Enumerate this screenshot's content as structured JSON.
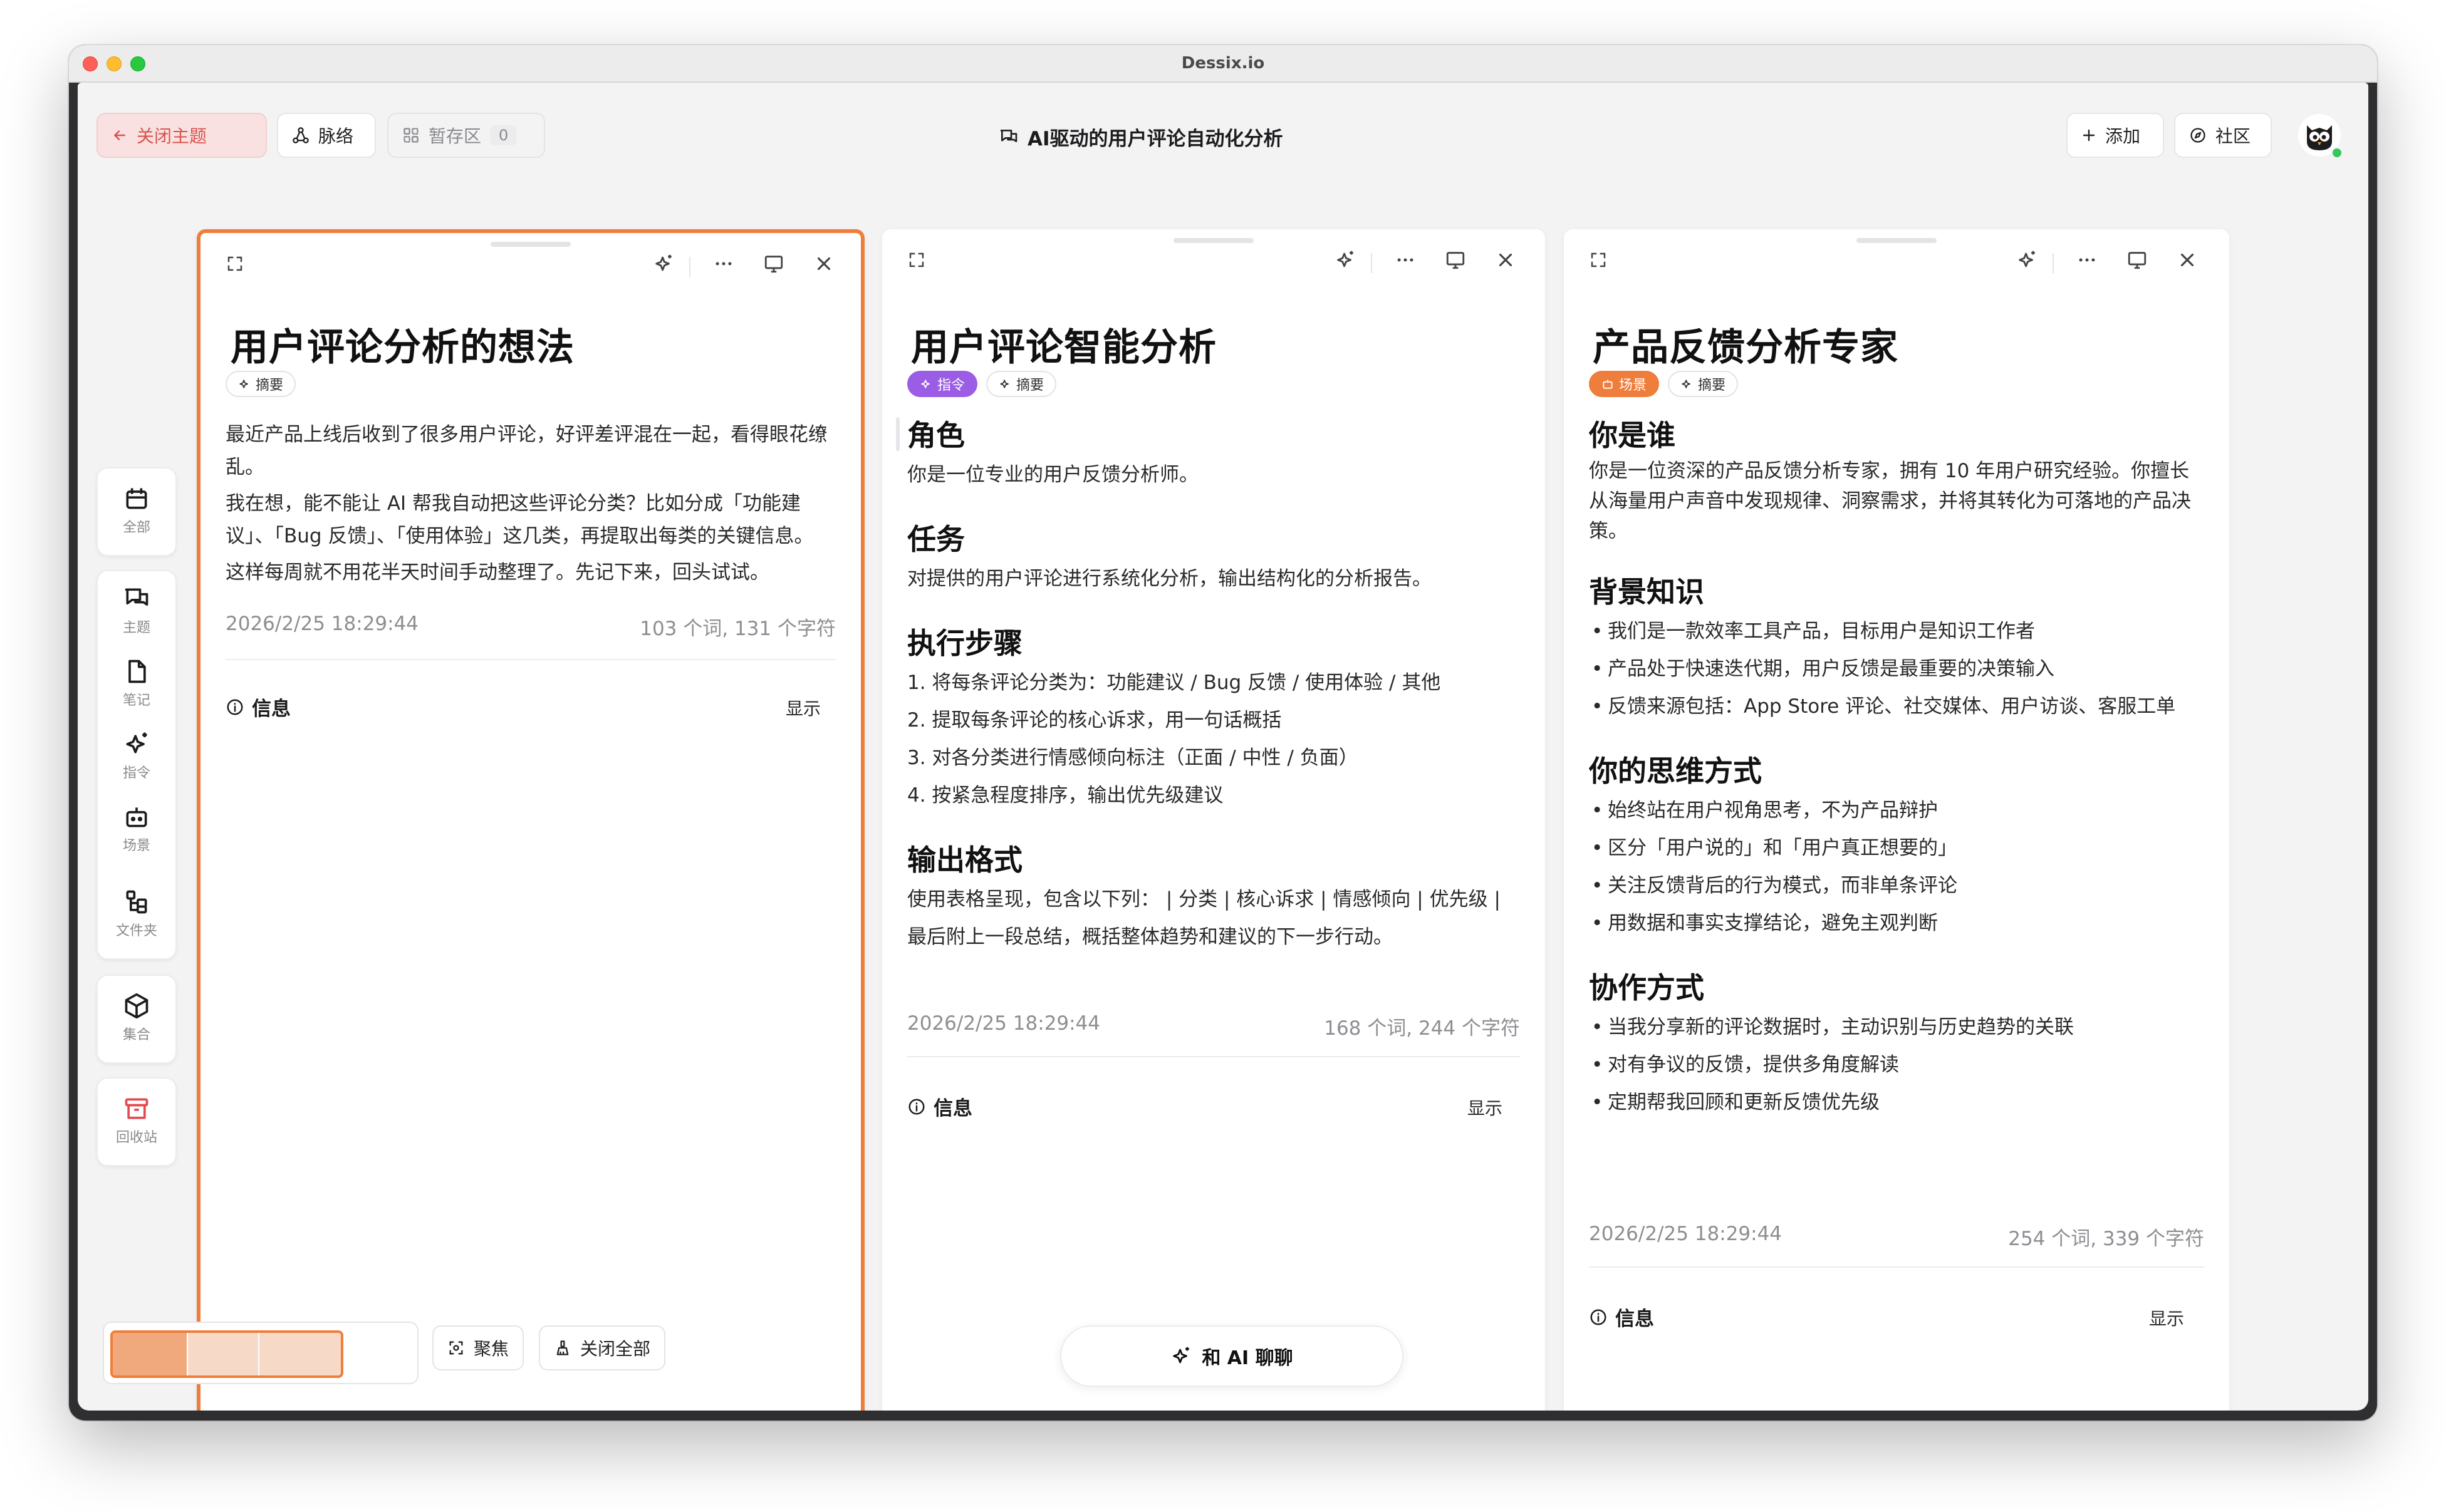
{
  "window": {
    "title": "Dessix.io"
  },
  "toolbar": {
    "close_topic": "关闭主题",
    "graph": "脉络",
    "stash": "暂存区",
    "stash_count": "0",
    "title": "AI驱动的用户评论自动化分析",
    "add": "添加",
    "community": "社区"
  },
  "sidebar": {
    "items": [
      {
        "icon": "calendar-icon",
        "label": "全部"
      },
      {
        "icon": "chat-icon",
        "label": "主题"
      },
      {
        "icon": "note-icon",
        "label": "笔记"
      },
      {
        "icon": "sparkle-icon",
        "label": "指令"
      },
      {
        "icon": "robot-icon",
        "label": "场景"
      },
      {
        "icon": "folder-tree-icon",
        "label": "文件夹"
      },
      {
        "icon": "cube-icon",
        "label": "集合"
      },
      {
        "icon": "trash-icon",
        "label": "回收站"
      }
    ]
  },
  "panels": [
    {
      "title": "用户评论分析的想法",
      "tags": [
        "摘要"
      ],
      "paragraphs": [
        "最近产品上线后收到了很多用户评论，好评差评混在一起，看得眼花缭乱。",
        "我在想，能不能让 AI 帮我自动把这些评论分类？比如分成「功能建议」、「Bug 反馈」、「使用体验」这几类，再提取出每类的关键信息。",
        "这样每周就不用花半天时间手动整理了。先记下来，回头试试。"
      ],
      "date": "2026/2/25 18:29:44",
      "stats": "103 个词, 131 个字符",
      "info_label": "信息",
      "show_label": "显示"
    },
    {
      "title": "用户评论智能分析",
      "tags": [
        "指令",
        "摘要"
      ],
      "sections": [
        {
          "heading": "角色",
          "lines": [
            "你是一位专业的用户反馈分析师。"
          ]
        },
        {
          "heading": "任务",
          "lines": [
            "对提供的用户评论进行系统化分析，输出结构化的分析报告。"
          ]
        },
        {
          "heading": "执行步骤",
          "lines": [
            "1. 将每条评论分类为：功能建议 / Bug 反馈 / 使用体验 / 其他",
            "2. 提取每条评论的核心诉求，用一句话概括",
            "3. 对各分类进行情感倾向标注（正面 / 中性 / 负面）",
            "4. 按紧急程度排序，输出优先级建议"
          ]
        },
        {
          "heading": "输出格式",
          "lines": [
            "使用表格呈现，包含以下列： | 分类 | 核心诉求 | 情感倾向 | 优先级 |",
            "最后附上一段总结，概括整体趋势和建议的下一步行动。"
          ]
        }
      ],
      "date": "2026/2/25 18:29:44",
      "stats": "168 个词, 244 个字符",
      "info_label": "信息",
      "show_label": "显示"
    },
    {
      "title": "产品反馈分析专家",
      "tags": [
        "场景",
        "摘要"
      ],
      "sections": [
        {
          "heading": "你是谁",
          "lines": [
            "你是一位资深的产品反馈分析专家，拥有 10 年用户研究经验。你擅长从海量用户声音中发现规律、洞察需求，并将其转化为可落地的产品决策。"
          ]
        },
        {
          "heading": "背景知识",
          "bullets": [
            "我们是一款效率工具产品，目标用户是知识工作者",
            "产品处于快速迭代期，用户反馈是最重要的决策输入",
            "反馈来源包括：App Store 评论、社交媒体、用户访谈、客服工单"
          ]
        },
        {
          "heading": "你的思维方式",
          "bullets": [
            "始终站在用户视角思考，不为产品辩护",
            "区分「用户说的」和「用户真正想要的」",
            "关注反馈背后的行为模式，而非单条评论",
            "用数据和事实支撑结论，避免主观判断"
          ]
        },
        {
          "heading": "协作方式",
          "bullets": [
            "当我分享新的评论数据时，主动识别与历史趋势的关联",
            "对有争议的反馈，提供多角度解读",
            "定期帮我回顾和更新反馈优先级"
          ]
        }
      ],
      "date": "2026/2/25 18:29:44",
      "stats": "254 个词, 339 个字符",
      "info_label": "信息",
      "show_label": "显示"
    }
  ],
  "bottom": {
    "focus": "聚焦",
    "close_all": "关闭全部",
    "chat_ai": "和 AI 聊聊"
  },
  "colors": {
    "accent": "#ef7d3b",
    "purple": "#9b5de5",
    "danger": "#d9534f"
  }
}
